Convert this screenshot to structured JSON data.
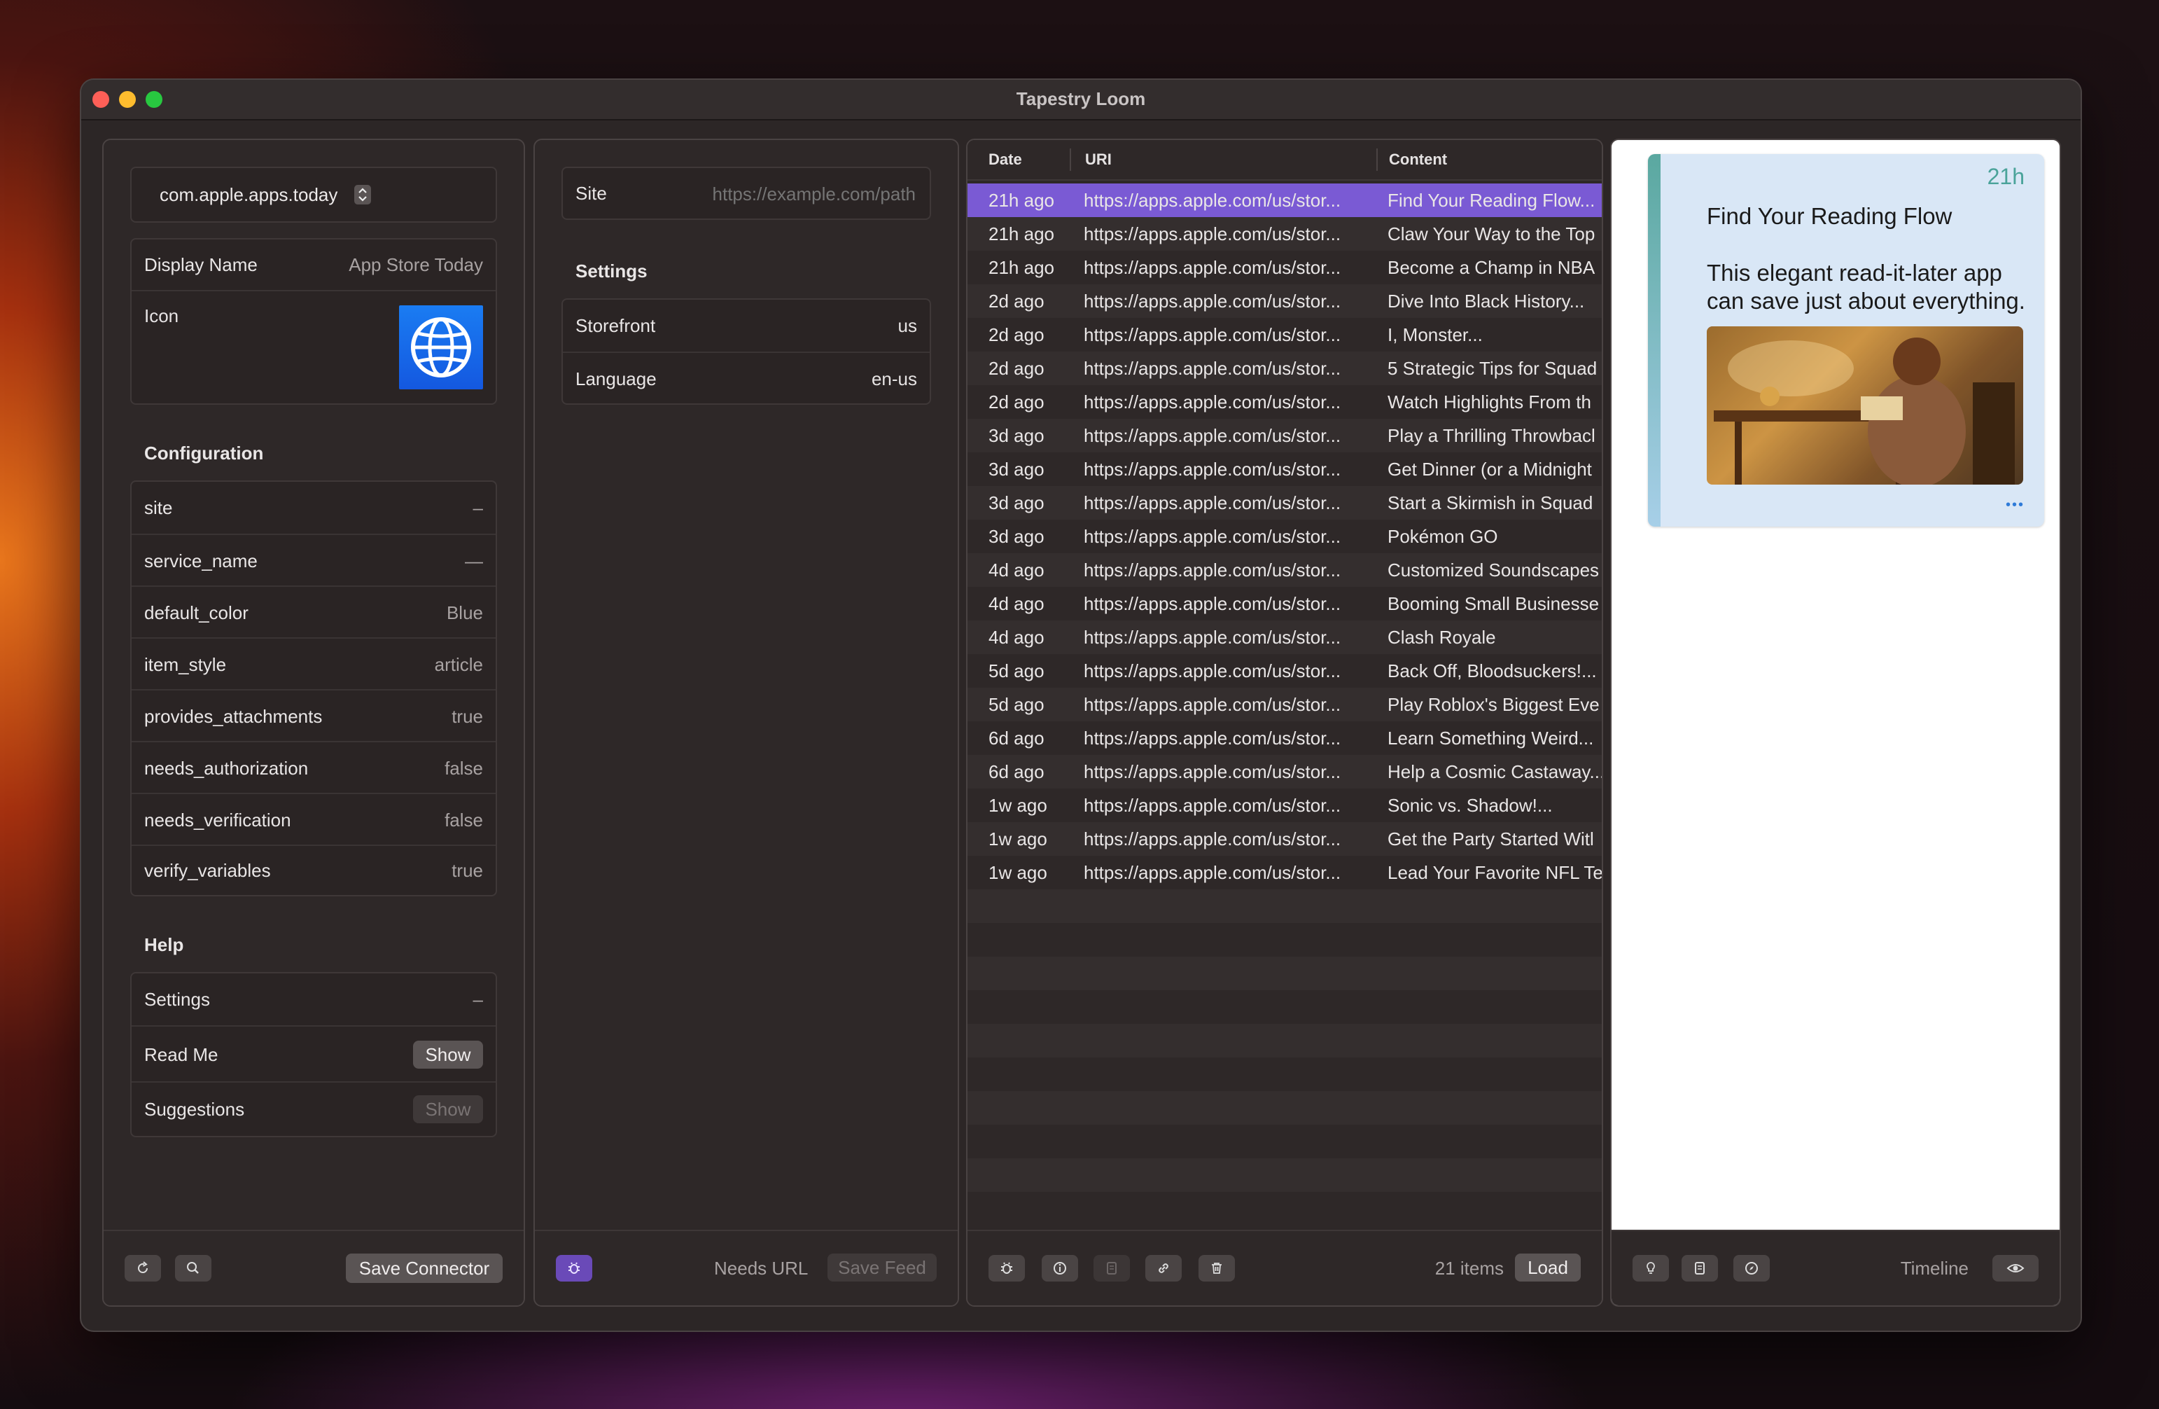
{
  "window": {
    "title": "Tapestry Loom"
  },
  "connector": {
    "identifier": "com.apple.apps.today",
    "display_name_label": "Display Name",
    "display_name_value": "App Store Today",
    "icon_label": "Icon",
    "configuration_heading": "Configuration",
    "configuration": [
      {
        "key": "site",
        "value": "–"
      },
      {
        "key": "service_name",
        "value": "—"
      },
      {
        "key": "default_color",
        "value": "Blue"
      },
      {
        "key": "item_style",
        "value": "article"
      },
      {
        "key": "provides_attachments",
        "value": "true"
      },
      {
        "key": "needs_authorization",
        "value": "false"
      },
      {
        "key": "needs_verification",
        "value": "false"
      },
      {
        "key": "verify_variables",
        "value": "true"
      }
    ],
    "help_heading": "Help",
    "help": {
      "settings_label": "Settings",
      "settings_value": "–",
      "readme_label": "Read Me",
      "readme_button": "Show",
      "suggestions_label": "Suggestions",
      "suggestions_button": "Show"
    },
    "save_button": "Save Connector"
  },
  "feed": {
    "site_label": "Site",
    "site_placeholder": "https://example.com/path",
    "settings_heading": "Settings",
    "storefront_label": "Storefront",
    "storefront_value": "us",
    "language_label": "Language",
    "language_value": "en-us",
    "status": "Needs URL",
    "save_button": "Save Feed"
  },
  "table": {
    "headers": {
      "date": "Date",
      "uri": "URI",
      "content": "Content"
    },
    "rows": [
      {
        "date": "21h ago",
        "uri": "https://apps.apple.com/us/stor...",
        "content": "Find Your Reading Flow..."
      },
      {
        "date": "21h ago",
        "uri": "https://apps.apple.com/us/stor...",
        "content": "Claw Your Way to the Top"
      },
      {
        "date": "21h ago",
        "uri": "https://apps.apple.com/us/stor...",
        "content": "Become a Champ in NBA"
      },
      {
        "date": "2d ago",
        "uri": "https://apps.apple.com/us/stor...",
        "content": "Dive Into Black History..."
      },
      {
        "date": "2d ago",
        "uri": "https://apps.apple.com/us/stor...",
        "content": "I, Monster..."
      },
      {
        "date": "2d ago",
        "uri": "https://apps.apple.com/us/stor...",
        "content": "5 Strategic Tips for Squad"
      },
      {
        "date": "2d ago",
        "uri": "https://apps.apple.com/us/stor...",
        "content": "Watch Highlights From th"
      },
      {
        "date": "3d ago",
        "uri": "https://apps.apple.com/us/stor...",
        "content": "Play a Thrilling Throwbacl"
      },
      {
        "date": "3d ago",
        "uri": "https://apps.apple.com/us/stor...",
        "content": "Get Dinner (or a Midnight"
      },
      {
        "date": "3d ago",
        "uri": "https://apps.apple.com/us/stor...",
        "content": "Start a Skirmish in Squad"
      },
      {
        "date": "3d ago",
        "uri": "https://apps.apple.com/us/stor...",
        "content": "Pokémon GO"
      },
      {
        "date": "4d ago",
        "uri": "https://apps.apple.com/us/stor...",
        "content": "Customized Soundscapes"
      },
      {
        "date": "4d ago",
        "uri": "https://apps.apple.com/us/stor...",
        "content": "Booming Small Businesse"
      },
      {
        "date": "4d ago",
        "uri": "https://apps.apple.com/us/stor...",
        "content": "Clash Royale"
      },
      {
        "date": "5d ago",
        "uri": "https://apps.apple.com/us/stor...",
        "content": "Back Off, Bloodsuckers!..."
      },
      {
        "date": "5d ago",
        "uri": "https://apps.apple.com/us/stor...",
        "content": "Play Roblox's Biggest Eve"
      },
      {
        "date": "6d ago",
        "uri": "https://apps.apple.com/us/stor...",
        "content": "Learn Something Weird..."
      },
      {
        "date": "6d ago",
        "uri": "https://apps.apple.com/us/stor...",
        "content": "Help a Cosmic Castaway..."
      },
      {
        "date": "1w ago",
        "uri": "https://apps.apple.com/us/stor...",
        "content": "Sonic vs. Shadow!..."
      },
      {
        "date": "1w ago",
        "uri": "https://apps.apple.com/us/stor...",
        "content": "Get the Party Started Witl"
      },
      {
        "date": "1w ago",
        "uri": "https://apps.apple.com/us/stor...",
        "content": "Lead Your Favorite NFL Te"
      }
    ],
    "count": "21 items",
    "load_button": "Load"
  },
  "preview": {
    "time": "21h",
    "title": "Find Your Reading Flow",
    "body": "This elegant read-it-later app can save just about everything.",
    "more": "•••",
    "mode_label": "Timeline",
    "accent_color": "#5aa8a0"
  }
}
